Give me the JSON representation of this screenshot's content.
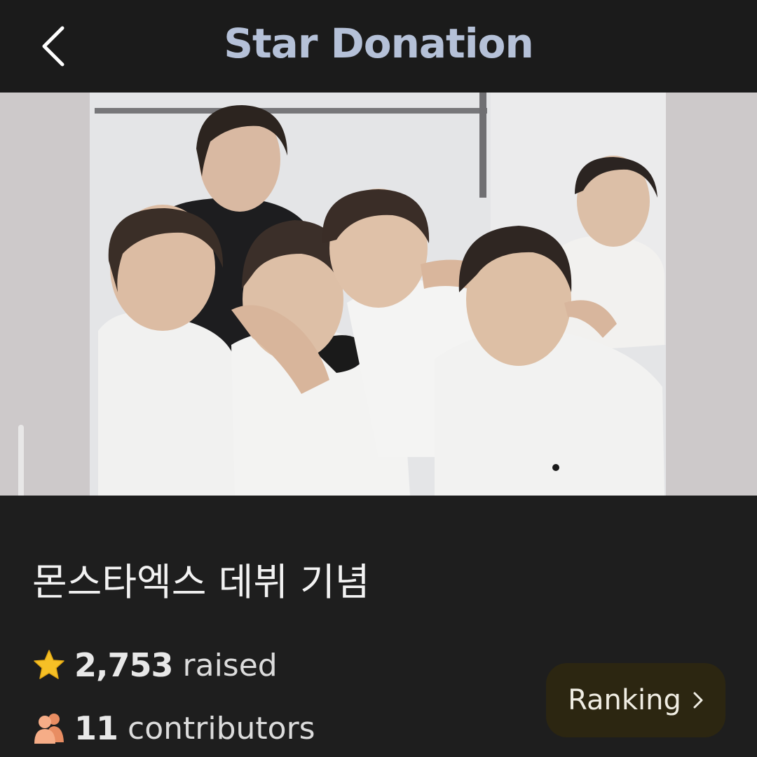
{
  "header": {
    "title": "Star Donation",
    "back_icon": "chevron-left-icon"
  },
  "banner": {
    "description_icon": "group-photo"
  },
  "event": {
    "name": "몬스타엑스 데뷔 기념"
  },
  "stats": {
    "raised_icon": "star-icon",
    "raised_value": "2,753",
    "raised_label": "raised",
    "contributors_icon": "people-icon",
    "contributors_value": "11",
    "contributors_label": "contributors"
  },
  "ranking_button": {
    "label": "Ranking",
    "icon": "chevron-right-icon"
  },
  "colors": {
    "background": "#1e1e1e",
    "header_bg": "#1b1b1b",
    "title": "#b5c1d8",
    "star": "#f6c026",
    "people": "#f2a37b",
    "ranking_bg": "#2c2611"
  }
}
